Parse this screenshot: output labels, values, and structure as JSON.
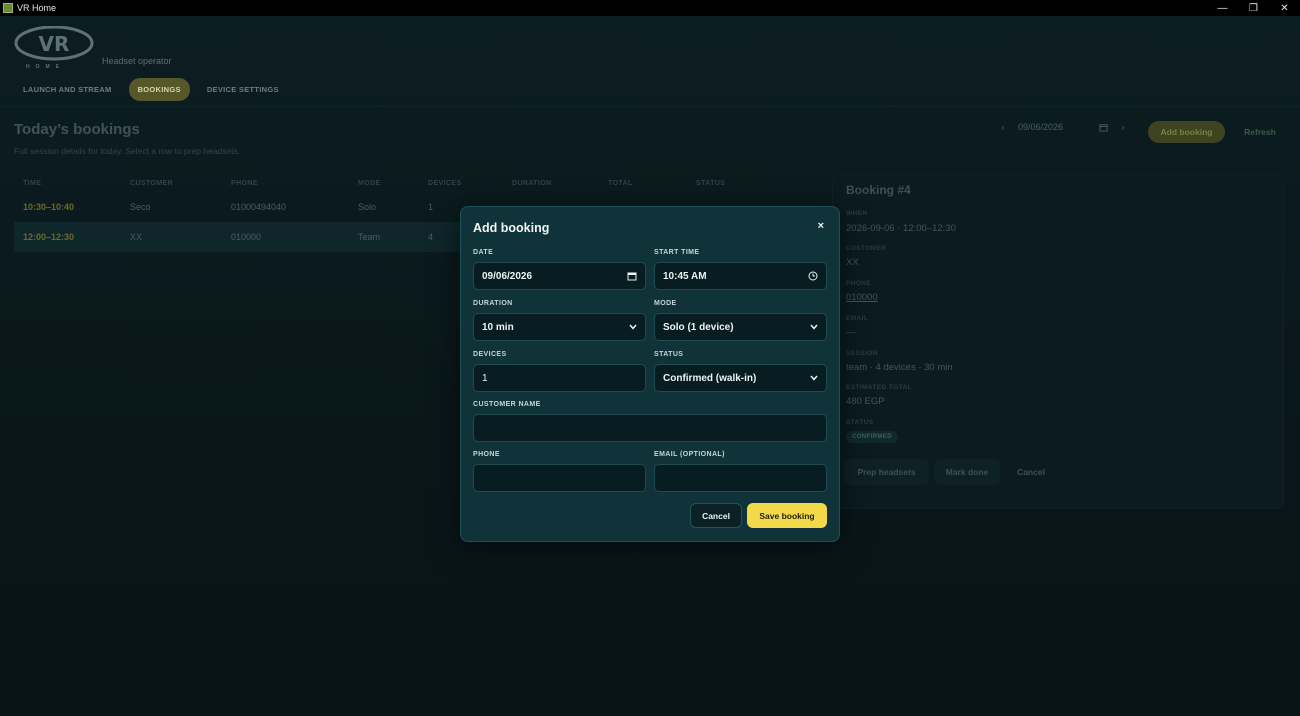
{
  "window": {
    "title": "VR Home",
    "minimize": "—",
    "restore": "❐",
    "close": "✕"
  },
  "brand": {
    "logo_text": "VR",
    "logo_sub": "HOME",
    "operator": "Headset operator"
  },
  "tabs": [
    {
      "label": "LAUNCH AND STREAM",
      "active": false
    },
    {
      "label": "BOOKINGS",
      "active": true
    },
    {
      "label": "DEVICE SETTINGS",
      "active": false
    }
  ],
  "page": {
    "title": "Today’s bookings",
    "subtitle": "Full session details for today. Select a row to prep headsets.",
    "date": "09/06/2026",
    "prev": "‹",
    "next": "›",
    "add_booking": "Add booking",
    "refresh": "Refresh"
  },
  "table": {
    "headers": [
      "TIME",
      "CUSTOMER",
      "PHONE",
      "MODE",
      "DEVICES",
      "DURATION",
      "TOTAL",
      "STATUS"
    ],
    "rows": [
      [
        "10:30–10:40",
        "Seco",
        "01000494040",
        "Solo",
        "1",
        "",
        "",
        ""
      ],
      [
        "12:00–12:30",
        "XX",
        "010000",
        "Team",
        "4",
        "",
        "",
        ""
      ]
    ]
  },
  "detail": {
    "title": "Booking #4",
    "when_label": "WHEN",
    "when": "2026-09-06 · 12:00–12:30",
    "customer_label": "CUSTOMER",
    "customer": "XX",
    "phone_label": "PHONE",
    "phone": "010000",
    "email_label": "EMAIL",
    "email": "—",
    "session_label": "SESSION",
    "session": "team · 4 devices · 30 min",
    "total_label": "ESTIMATED TOTAL",
    "total": "480 EGP",
    "status_label": "STATUS",
    "status": "CONFIRMED",
    "prep": "Prep headsets",
    "done": "Mark done",
    "cancel": "Cancel"
  },
  "modal": {
    "title": "Add booking",
    "close": "×",
    "date_label": "DATE",
    "date": "09/06/2026",
    "start_label": "START TIME",
    "start": "10:45 AM",
    "duration_label": "DURATION",
    "duration": "10 min",
    "mode_label": "MODE",
    "mode": "Solo (1 device)",
    "devices_label": "DEVICES",
    "devices": "1",
    "status_label": "STATUS",
    "status": "Confirmed (walk-in)",
    "customer_label": "CUSTOMER NAME",
    "customer": "",
    "phone_label": "PHONE",
    "phone": "",
    "email_label": "EMAIL (OPTIONAL)",
    "email": "",
    "cancel": "Cancel",
    "save": "Save booking"
  },
  "colors": {
    "accent": "#f2d94a",
    "modal_bg": "#0f3339",
    "page_bg": "#0a1619"
  }
}
